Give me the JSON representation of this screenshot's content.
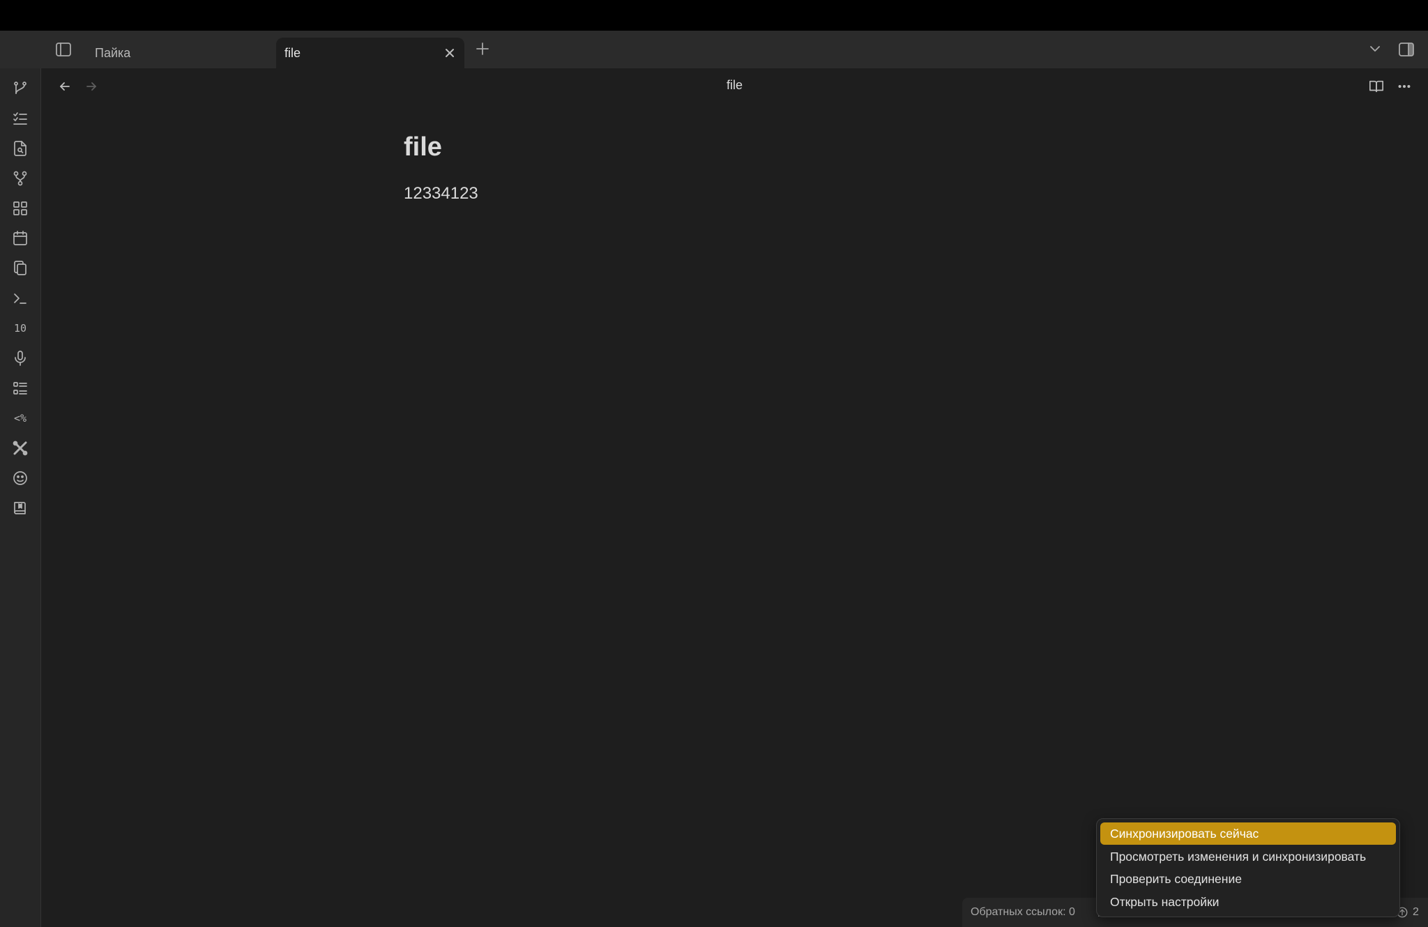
{
  "tabs": [
    {
      "label": "Пайка"
    },
    {
      "label": "file"
    }
  ],
  "view": {
    "title": "file"
  },
  "note": {
    "title": "file",
    "body": "12334123"
  },
  "ribbon": {
    "items": [
      "git-branch-icon",
      "checklist-icon",
      "file-search-icon",
      "graph-icon",
      "grid-icon",
      "calendar-icon",
      "copy-icon",
      "terminal-icon",
      "numbers-icon",
      "microphone-icon",
      "list-icon",
      "templater-icon",
      "tools-icon",
      "face-icon",
      "bookmark-book-icon"
    ],
    "numbers_glyph": "10",
    "templater_glyph": "<%"
  },
  "status": {
    "backlinks": "Обратных ссылок: 0",
    "sync_count": "2"
  },
  "menu": {
    "items": [
      {
        "label": "Синхронизировать сейчас",
        "selected": true
      },
      {
        "label": "Просмотреть изменения и синхронизировать",
        "selected": false
      },
      {
        "label": "Проверить соединение",
        "selected": false
      },
      {
        "label": "Открыть настройки",
        "selected": false
      }
    ]
  },
  "colors": {
    "accent": "#c49210",
    "background": "#1e1e1e",
    "tabbar": "#2b2b2b"
  }
}
